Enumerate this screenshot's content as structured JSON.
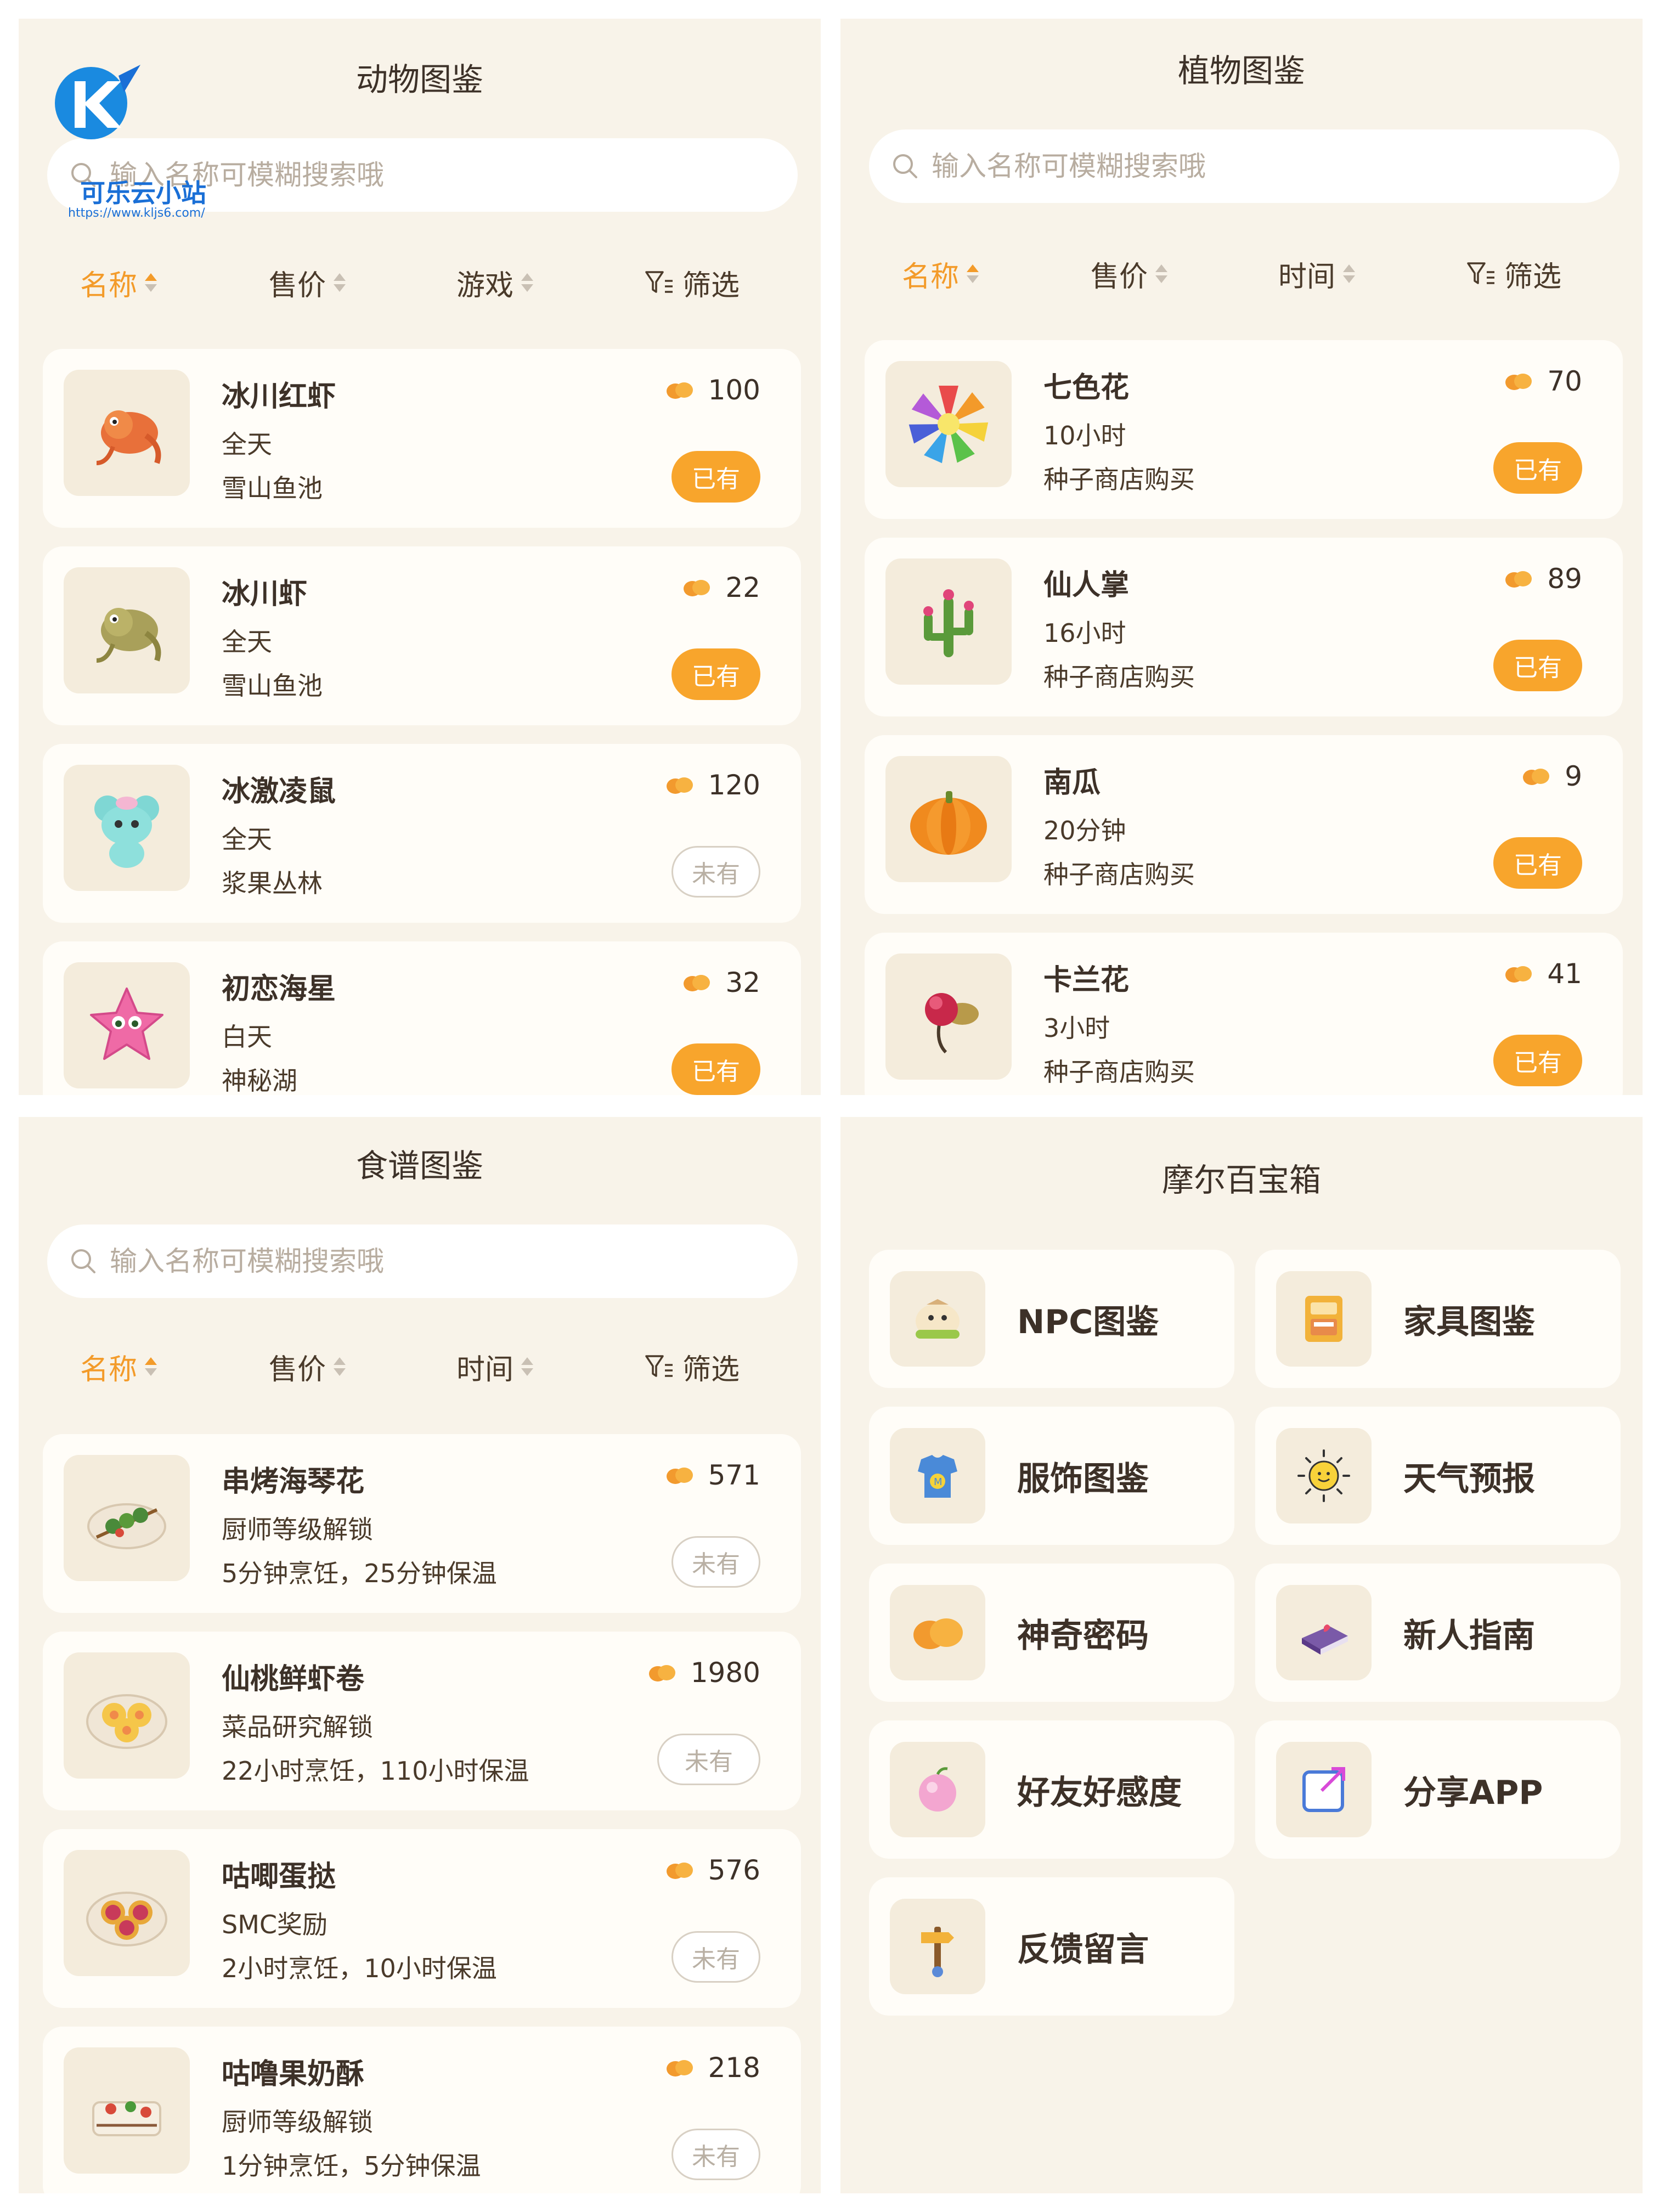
{
  "watermark": {
    "text": "可乐云小站",
    "url": "https://www.kljs6.com/"
  },
  "animals": {
    "title": "动物图鉴",
    "search_placeholder": "输入名称可模糊搜索哦",
    "sort": [
      "名称",
      "售价",
      "游戏"
    ],
    "filter": "筛选",
    "items": [
      {
        "name": "冰川红虾",
        "l1": "全天",
        "l2": "雪山鱼池",
        "price": "100",
        "status": "已有"
      },
      {
        "name": "冰川虾",
        "l1": "全天",
        "l2": "雪山鱼池",
        "price": "22",
        "status": "已有"
      },
      {
        "name": "冰激凌鼠",
        "l1": "全天",
        "l2": "浆果丛林",
        "price": "120",
        "status": "未有"
      },
      {
        "name": "初恋海星",
        "l1": "白天",
        "l2": "神秘湖",
        "price": "32",
        "status": "已有"
      }
    ]
  },
  "plants": {
    "title": "植物图鉴",
    "search_placeholder": "输入名称可模糊搜索哦",
    "sort": [
      "名称",
      "售价",
      "时间"
    ],
    "filter": "筛选",
    "items": [
      {
        "name": "七色花",
        "l1": "10小时",
        "l2": "种子商店购买",
        "price": "70",
        "status": "已有"
      },
      {
        "name": "仙人掌",
        "l1": "16小时",
        "l2": "种子商店购买",
        "price": "89",
        "status": "已有"
      },
      {
        "name": "南瓜",
        "l1": "20分钟",
        "l2": "种子商店购买",
        "price": "9",
        "status": "已有"
      },
      {
        "name": "卡兰花",
        "l1": "3小时",
        "l2": "种子商店购买",
        "price": "41",
        "status": "已有"
      }
    ]
  },
  "recipes": {
    "title": "食谱图鉴",
    "search_placeholder": "输入名称可模糊搜索哦",
    "sort": [
      "名称",
      "售价",
      "时间"
    ],
    "filter": "筛选",
    "items": [
      {
        "name": "串烤海琴花",
        "l1": "厨师等级解锁",
        "l2": "5分钟烹饪，25分钟保温",
        "price": "571",
        "status": "未有"
      },
      {
        "name": "仙桃鲜虾卷",
        "l1": "菜品研究解锁",
        "l2": "22小时烹饪，110小时保温",
        "price": "1980",
        "status": "未有"
      },
      {
        "name": "咕唧蛋挞",
        "l1": "SMC奖励",
        "l2": "2小时烹饪，10小时保温",
        "price": "576",
        "status": "未有"
      },
      {
        "name": "咕噜果奶酥",
        "l1": "厨师等级解锁",
        "l2": "1分钟烹饪，5分钟保温",
        "price": "218",
        "status": "未有"
      }
    ]
  },
  "box": {
    "title": "摩尔百宝箱",
    "tiles": [
      "NPC图鉴",
      "家具图鉴",
      "服饰图鉴",
      "天气预报",
      "神奇密码",
      "新人指南",
      "好友好感度",
      "分享APP",
      "反馈留言"
    ]
  },
  "colors": {
    "accent": "#f39b2a",
    "badge_owned": "#f8a52c",
    "panel_bg": "#f8f3e9"
  }
}
